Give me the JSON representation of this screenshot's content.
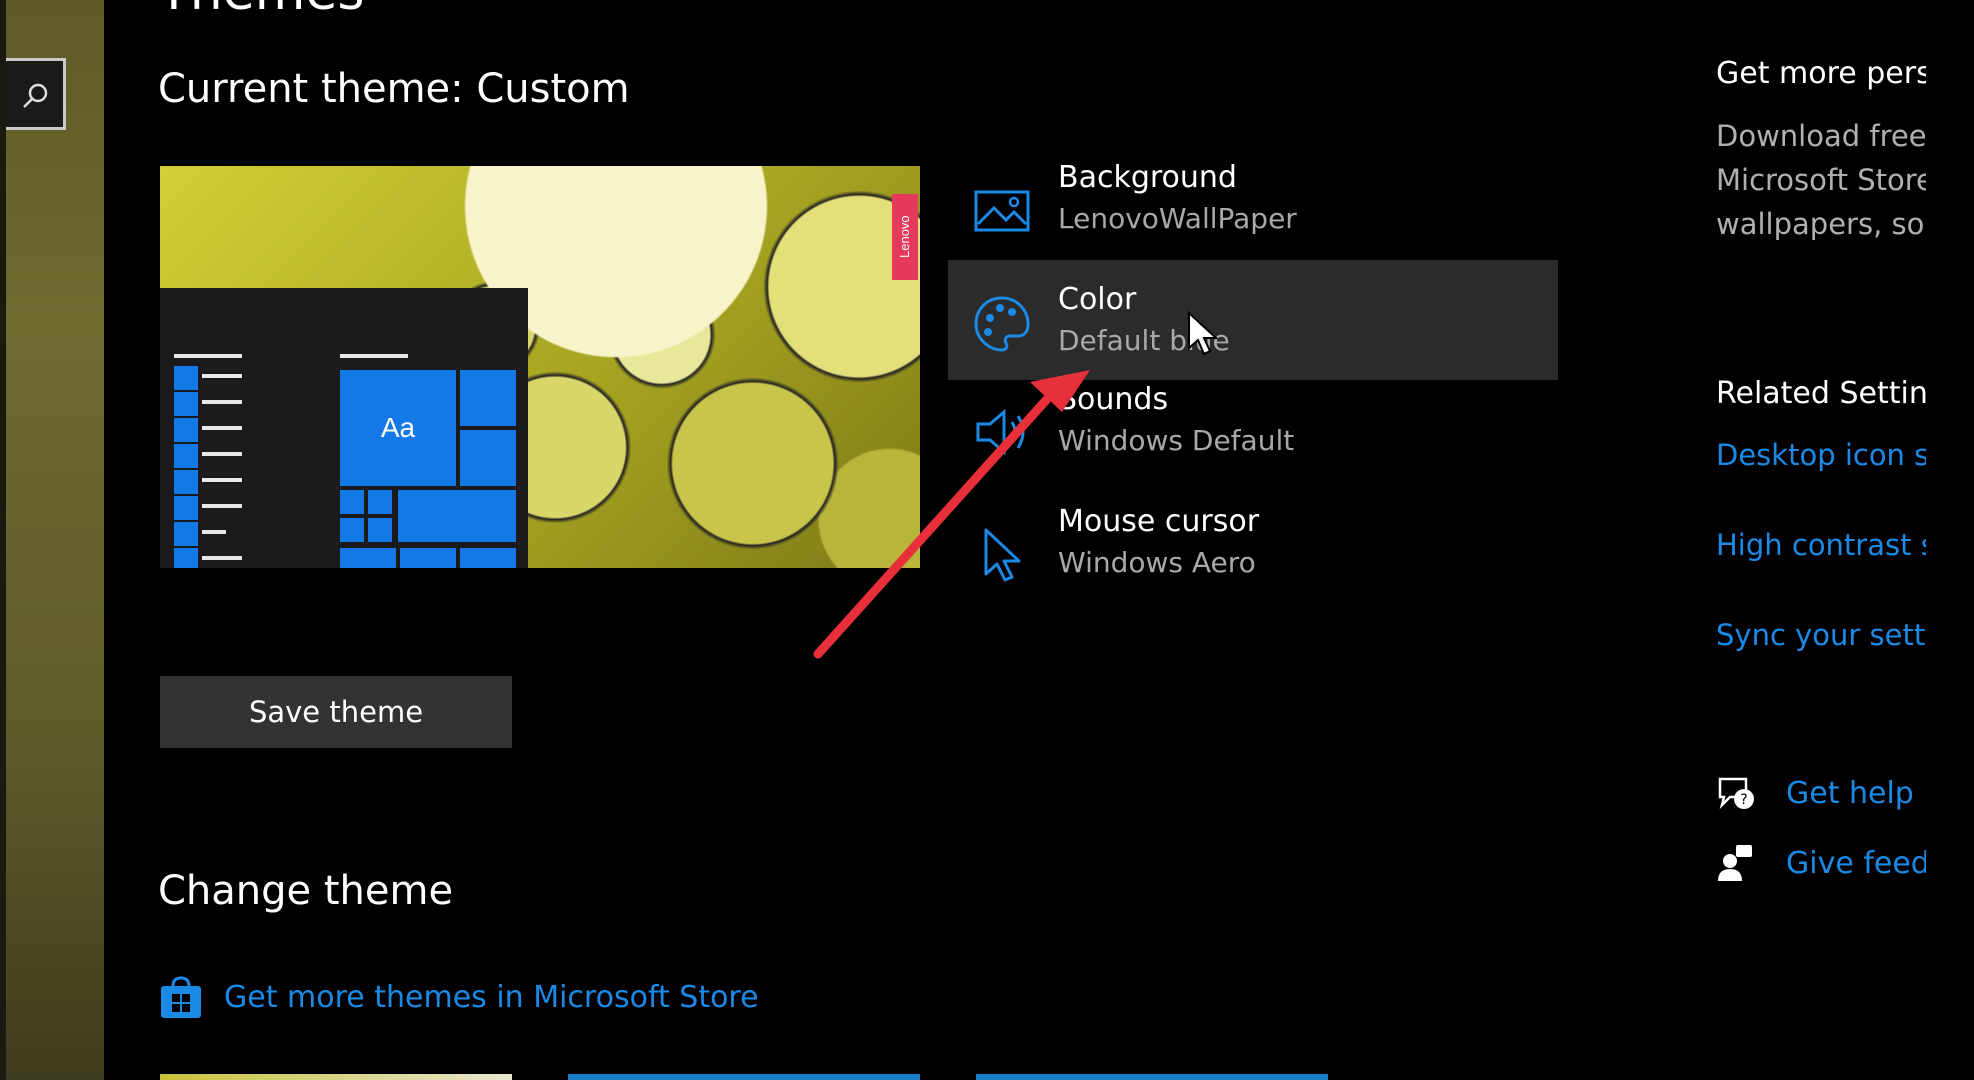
{
  "page": {
    "partial_title": "Themes",
    "current_theme_heading": "Current theme: Custom",
    "change_theme_heading": "Change theme",
    "save_button": "Save theme",
    "store_link": "Get more themes in Microsoft Store"
  },
  "preview": {
    "tile_label": "Aa",
    "brand_tag": "Lenovo"
  },
  "theme_options": [
    {
      "title": "Background",
      "value": "LenovoWallPaper",
      "icon": "picture-icon"
    },
    {
      "title": "Color",
      "value": "Default blue",
      "icon": "palette-icon",
      "highlighted": true
    },
    {
      "title": "Sounds",
      "value": "Windows Default",
      "icon": "speaker-icon"
    },
    {
      "title": "Mouse cursor",
      "value": "Windows Aero",
      "icon": "cursor-icon"
    }
  ],
  "side": {
    "get_more_heading": "Get more perso",
    "get_more_lines": [
      "Download free",
      "Microsoft Store",
      "wallpapers, sou"
    ],
    "related_heading": "Related Setting",
    "related_links": [
      "Desktop icon s",
      "High contrast s",
      "Sync your setti"
    ],
    "help": "Get help",
    "feedback": "Give feed"
  },
  "colors": {
    "accent": "#1a8ae6",
    "annotation_arrow": "#e8303a",
    "highlight_row": "#2b2b2b"
  }
}
